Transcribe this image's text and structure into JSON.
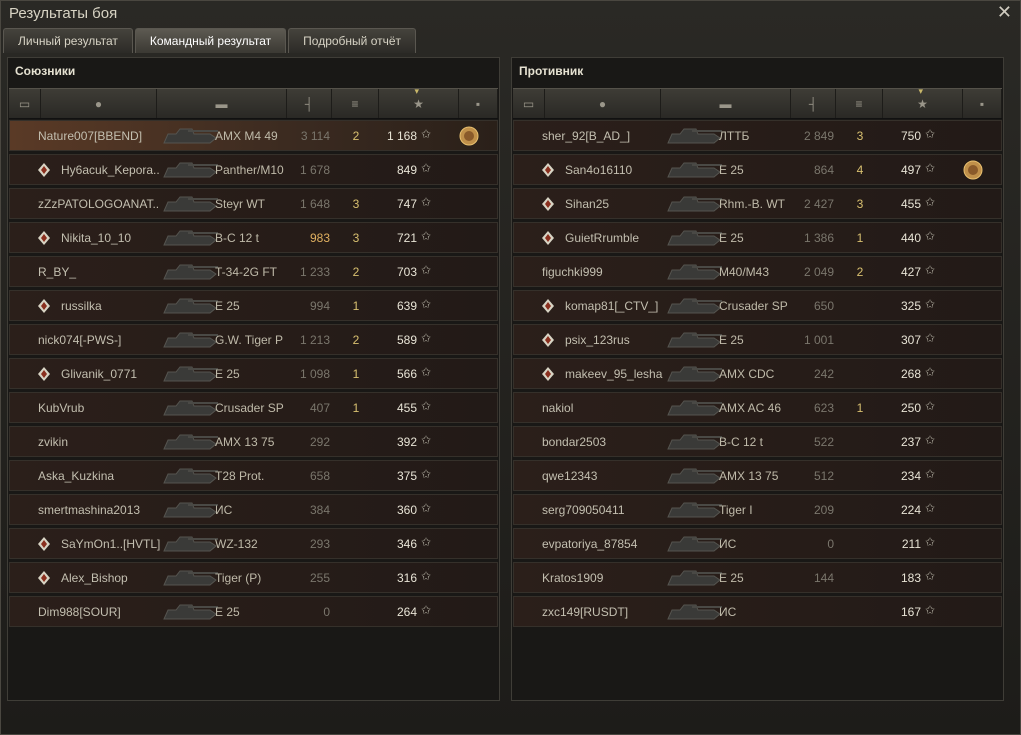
{
  "window": {
    "title": "Результаты боя",
    "close_icon": "close-icon"
  },
  "tabs": [
    {
      "label": "Личный результат",
      "active": false
    },
    {
      "label": "Командный результат",
      "active": true
    },
    {
      "label": "Подробный отчёт",
      "active": false
    }
  ],
  "columns": [
    "platoon-icon",
    "player-icon",
    "tank-icon",
    "damage-icon",
    "frags-icon",
    "xp-star-icon",
    "medal-icon"
  ],
  "allies": {
    "title": "Союзники",
    "rows": [
      {
        "name": "Nature007[BBEND]",
        "badge": "",
        "tank": "AMX M4 49",
        "damage": "3 114",
        "kills": "2",
        "xp": "1 168",
        "medal": true,
        "me": true
      },
      {
        "name": "Hy6acuk_Kepora..",
        "badge": "badge",
        "tank": "Panther/M10",
        "damage": "1 678",
        "kills": "",
        "xp": "849",
        "medal": false
      },
      {
        "name": "zZzPATOLOGOANAT..",
        "badge": "",
        "tank": "Steyr WT",
        "damage": "1 648",
        "kills": "3",
        "xp": "747",
        "medal": false
      },
      {
        "name": "Nikita_10_10",
        "badge": "badge",
        "tank": "B-C 12 t",
        "damage": "983",
        "kills": "3",
        "xp": "721",
        "medal": false,
        "gold": true
      },
      {
        "name": "R_BY_",
        "badge": "",
        "tank": "T-34-2G FT",
        "damage": "1 233",
        "kills": "2",
        "xp": "703",
        "medal": false
      },
      {
        "name": "russilka",
        "badge": "badge",
        "tank": "E 25",
        "damage": "994",
        "kills": "1",
        "xp": "639",
        "medal": false
      },
      {
        "name": "nick074[-PWS-]",
        "badge": "",
        "tank": "G.W. Tiger P",
        "damage": "1 213",
        "kills": "2",
        "xp": "589",
        "medal": false
      },
      {
        "name": "Glivanik_0771",
        "badge": "badge",
        "tank": "E 25",
        "damage": "1 098",
        "kills": "1",
        "xp": "566",
        "medal": false
      },
      {
        "name": "KubVrub",
        "badge": "",
        "tank": "Crusader SP",
        "damage": "407",
        "kills": "1",
        "xp": "455",
        "medal": false
      },
      {
        "name": "zvikin",
        "badge": "",
        "tank": "AMX 13 75",
        "damage": "292",
        "kills": "",
        "xp": "392",
        "medal": false
      },
      {
        "name": "Aska_Kuzkina",
        "badge": "",
        "tank": "T28 Prot.",
        "damage": "658",
        "kills": "",
        "xp": "375",
        "medal": false
      },
      {
        "name": "smertmashina2013",
        "badge": "",
        "tank": "ИС",
        "damage": "384",
        "kills": "",
        "xp": "360",
        "medal": false
      },
      {
        "name": "SaYmOn1..[HVTL]",
        "badge": "badge",
        "tank": "WZ-132",
        "damage": "293",
        "kills": "",
        "xp": "346",
        "medal": false
      },
      {
        "name": "Alex_Bishop",
        "badge": "badge",
        "tank": "Tiger (P)",
        "damage": "255",
        "kills": "",
        "xp": "316",
        "medal": false
      },
      {
        "name": "Dim988[SOUR]",
        "badge": "",
        "tank": "E 25",
        "damage": "0",
        "kills": "",
        "xp": "264",
        "medal": false
      }
    ]
  },
  "enemies": {
    "title": "Противник",
    "rows": [
      {
        "name": "sher_92[B_AD_]",
        "badge": "",
        "tank": "ЛТТБ",
        "damage": "2 849",
        "kills": "3",
        "xp": "750",
        "medal": false
      },
      {
        "name": "San4o16110",
        "badge": "badge",
        "tank": "E 25",
        "damage": "864",
        "kills": "4",
        "xp": "497",
        "medal": true
      },
      {
        "name": "Sihan25",
        "badge": "badge",
        "tank": "Rhm.-B. WT",
        "damage": "2 427",
        "kills": "3",
        "xp": "455",
        "medal": false
      },
      {
        "name": "GuietRrumble",
        "badge": "badge",
        "tank": "E 25",
        "damage": "1 386",
        "kills": "1",
        "xp": "440",
        "medal": false
      },
      {
        "name": "figuchki999",
        "badge": "",
        "tank": "M40/M43",
        "damage": "2 049",
        "kills": "2",
        "xp": "427",
        "medal": false
      },
      {
        "name": "komap81[_CTV_]",
        "badge": "badge",
        "tank": "Crusader SP",
        "damage": "650",
        "kills": "",
        "xp": "325",
        "medal": false
      },
      {
        "name": "psix_123rus",
        "badge": "badge",
        "tank": "E 25",
        "damage": "1 001",
        "kills": "",
        "xp": "307",
        "medal": false
      },
      {
        "name": "makeev_95_lesha",
        "badge": "badge",
        "tank": "AMX CDC",
        "damage": "242",
        "kills": "",
        "xp": "268",
        "medal": false
      },
      {
        "name": "nakiol",
        "badge": "",
        "tank": "AMX AC 46",
        "damage": "623",
        "kills": "1",
        "xp": "250",
        "medal": false
      },
      {
        "name": "bondar2503",
        "badge": "",
        "tank": "B-C 12 t",
        "damage": "522",
        "kills": "",
        "xp": "237",
        "medal": false
      },
      {
        "name": "qwe12343",
        "badge": "",
        "tank": "AMX 13 75",
        "damage": "512",
        "kills": "",
        "xp": "234",
        "medal": false
      },
      {
        "name": "serg709050411",
        "badge": "",
        "tank": "Tiger I",
        "damage": "209",
        "kills": "",
        "xp": "224",
        "medal": false
      },
      {
        "name": "evpatoriya_87854",
        "badge": "",
        "tank": "ИС",
        "damage": "0",
        "kills": "",
        "xp": "211",
        "medal": false
      },
      {
        "name": "Kratos1909",
        "badge": "",
        "tank": "E 25",
        "damage": "144",
        "kills": "",
        "xp": "183",
        "medal": false
      },
      {
        "name": "zxc149[RUSDT]",
        "badge": "",
        "tank": "ИС",
        "damage": "",
        "kills": "",
        "xp": "167",
        "medal": false
      }
    ]
  }
}
